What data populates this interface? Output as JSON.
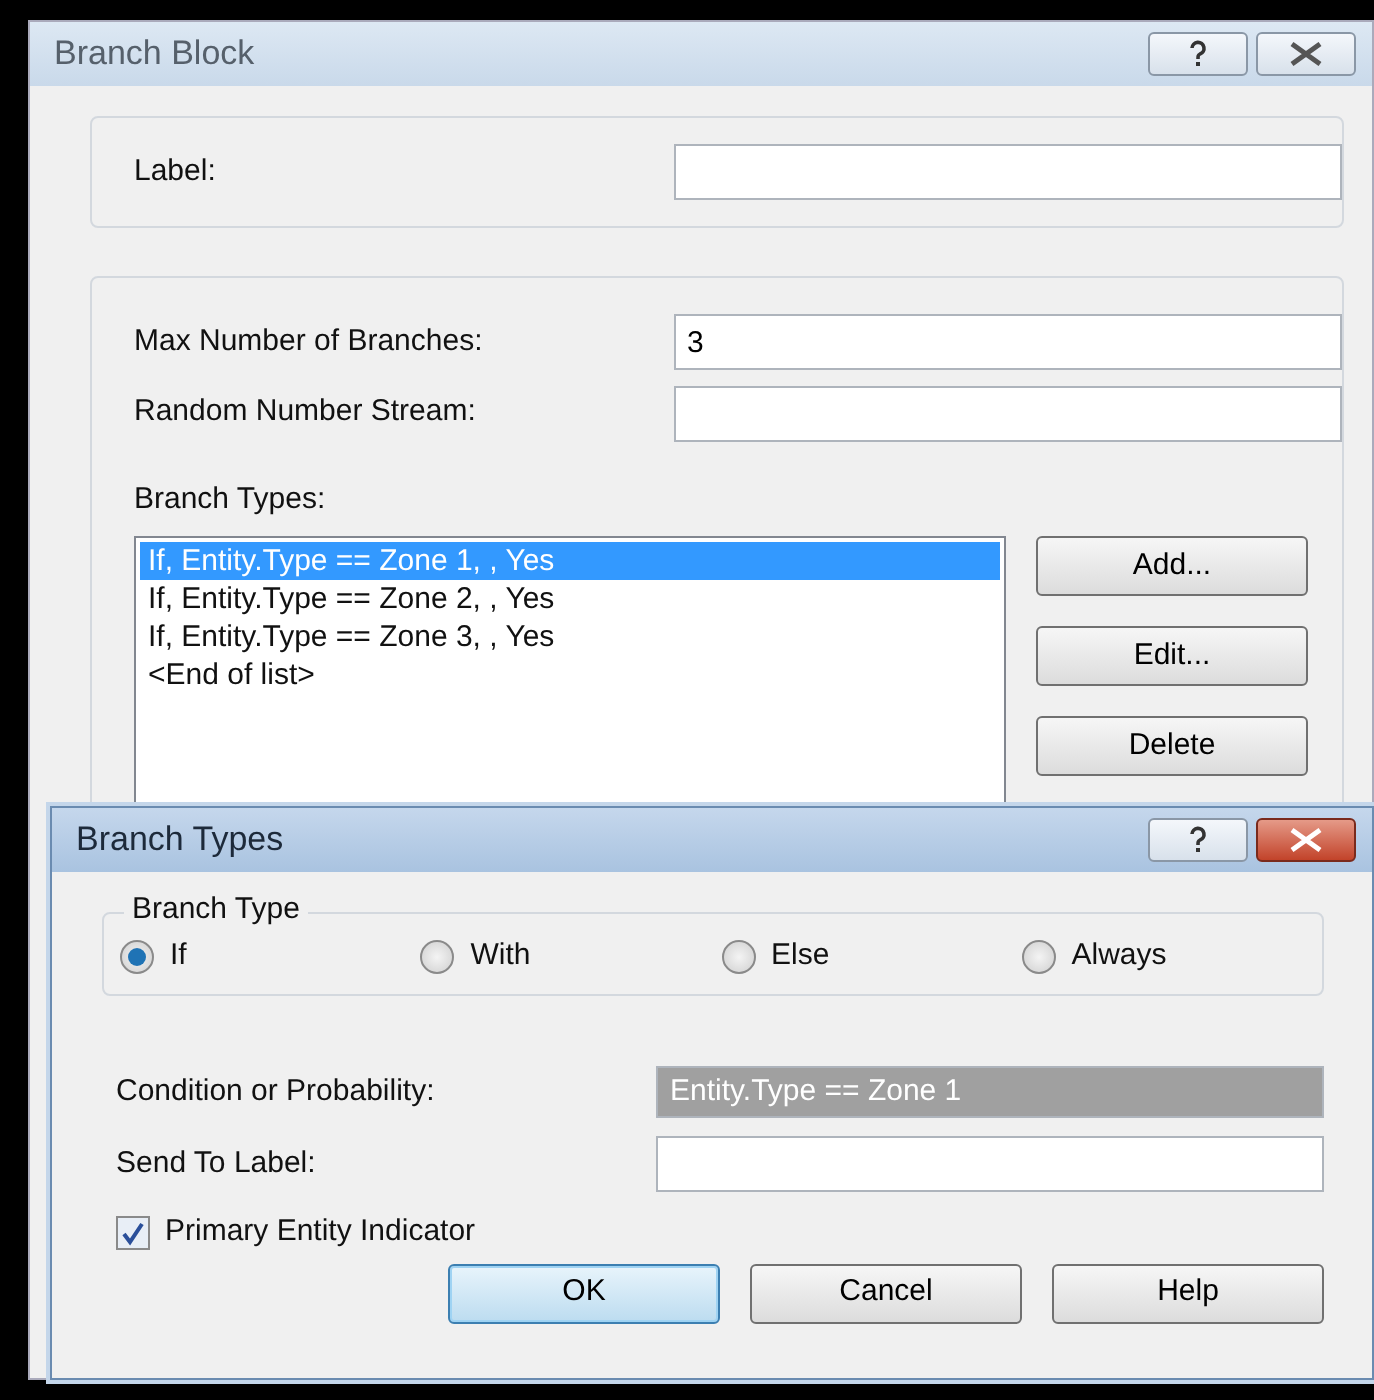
{
  "main_window": {
    "title": "Branch Block",
    "label_field": {
      "label": "Label:"
    },
    "fields": [
      {
        "label": "Max Number of Branches:",
        "value": "3"
      },
      {
        "label": "Random Number Stream:"
      }
    ],
    "branch_types": {
      "label": "Branch Types:",
      "items": [
        {
          "text": "If, Entity.Type == Zone 1, , Yes",
          "selected": true
        },
        {
          "text": "If, Entity.Type == Zone 2, , Yes",
          "selected": false
        },
        {
          "text": "If, Entity.Type == Zone 3, , Yes",
          "selected": false
        },
        {
          "text": "<End of list>",
          "selected": false
        }
      ],
      "buttons": [
        "Add...",
        "Edit...",
        "Delete"
      ]
    }
  },
  "dialog": {
    "title": "Branch Types",
    "group_title": "Branch Type",
    "options": [
      {
        "label": "If",
        "selected": true
      },
      {
        "label": "With",
        "selected": false
      },
      {
        "label": "Else",
        "selected": false
      },
      {
        "label": "Always",
        "selected": false
      }
    ],
    "condition": {
      "label": "Condition or Probability:",
      "value": "Entity.Type == Zone 1",
      "highlighted": true
    },
    "send_to": {
      "label": "Send To Label:"
    },
    "primary": {
      "label": "Primary Entity Indicator",
      "checked": true
    },
    "buttons": [
      {
        "label": "OK",
        "default": true
      },
      {
        "label": "Cancel",
        "default": false
      },
      {
        "label": "Help",
        "default": false
      }
    ]
  }
}
